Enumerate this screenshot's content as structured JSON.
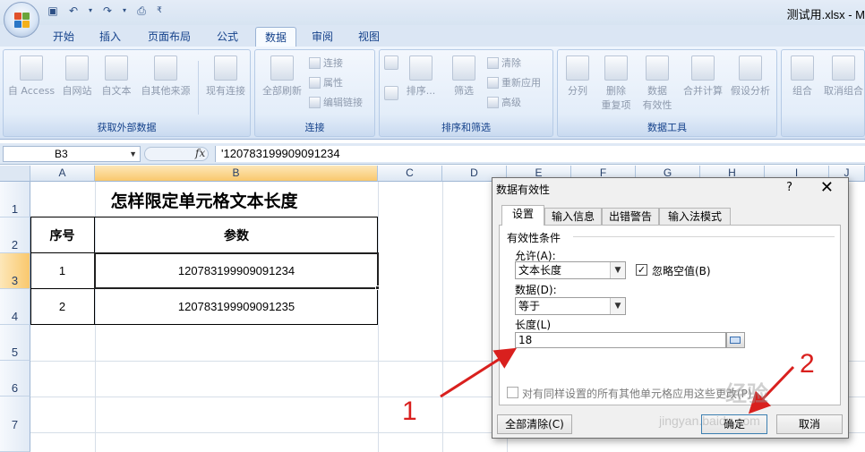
{
  "window": {
    "title": "测试用.xlsx - M"
  },
  "quick_access": [
    "save-icon",
    "undo-icon",
    "redo-icon",
    "print-preview-icon",
    "customize-icon"
  ],
  "tabs": [
    "开始",
    "插入",
    "页面布局",
    "公式",
    "数据",
    "审阅",
    "视图"
  ],
  "active_tab": "数据",
  "ribbon": {
    "external": {
      "label": "获取外部数据",
      "buttons": [
        "自 Access",
        "自网站",
        "自文本",
        "自其他来源",
        "现有连接"
      ]
    },
    "connections": {
      "label": "连接",
      "refresh": "全部刷新",
      "items": [
        "连接",
        "属性",
        "编辑链接"
      ]
    },
    "sort": {
      "label": "排序和筛选",
      "sort": "排序...",
      "filter": "筛选",
      "items": [
        "清除",
        "重新应用",
        "高级"
      ]
    },
    "tools": {
      "label": "数据工具",
      "split": "分列",
      "dedupe": [
        "删除",
        "重复项"
      ],
      "validation": [
        "数据",
        "有效性"
      ],
      "consolidate": "合并计算",
      "whatif": "假设分析"
    },
    "outline": {
      "group": "组合",
      "ungroup": "取消组合"
    }
  },
  "formula_bar": {
    "name_box": "B3",
    "fx": "fx",
    "formula": "'120783199909091234"
  },
  "columns": [
    "A",
    "B",
    "C",
    "D",
    "E",
    "F",
    "G",
    "H",
    "I",
    "J"
  ],
  "rows": [
    "1",
    "2",
    "3",
    "4",
    "5",
    "6",
    "7"
  ],
  "sheet": {
    "title": "怎样限定单元格文本长度",
    "headers": [
      "序号",
      "参数"
    ],
    "data": [
      [
        "1",
        "120783199909091234"
      ],
      [
        "2",
        "120783199909091235"
      ]
    ]
  },
  "dialog": {
    "title": "数据有效性",
    "help": "?",
    "close": "✕",
    "tabs": [
      "设置",
      "输入信息",
      "出错警告",
      "输入法模式"
    ],
    "section": "有效性条件",
    "allow_label": "允许(A):",
    "allow_value": "文本长度",
    "ignore_blank": "忽略空值(B)",
    "data_label": "数据(D):",
    "data_value": "等于",
    "length_label": "长度(L)",
    "length_value": "18",
    "apply_all": "对有同样设置的所有其他单元格应用这些更改(P)",
    "clear_all": "全部清除(C)",
    "ok": "确定",
    "cancel": "取消"
  },
  "annotations": {
    "n1": "1",
    "n2": "2"
  },
  "watermark": {
    "brand": "经验",
    "url": "jingyan.baidu.com"
  },
  "colors": {
    "annotation": "#d9201e",
    "ribbon_text": "#15428b",
    "selection": "#f9c86d"
  }
}
